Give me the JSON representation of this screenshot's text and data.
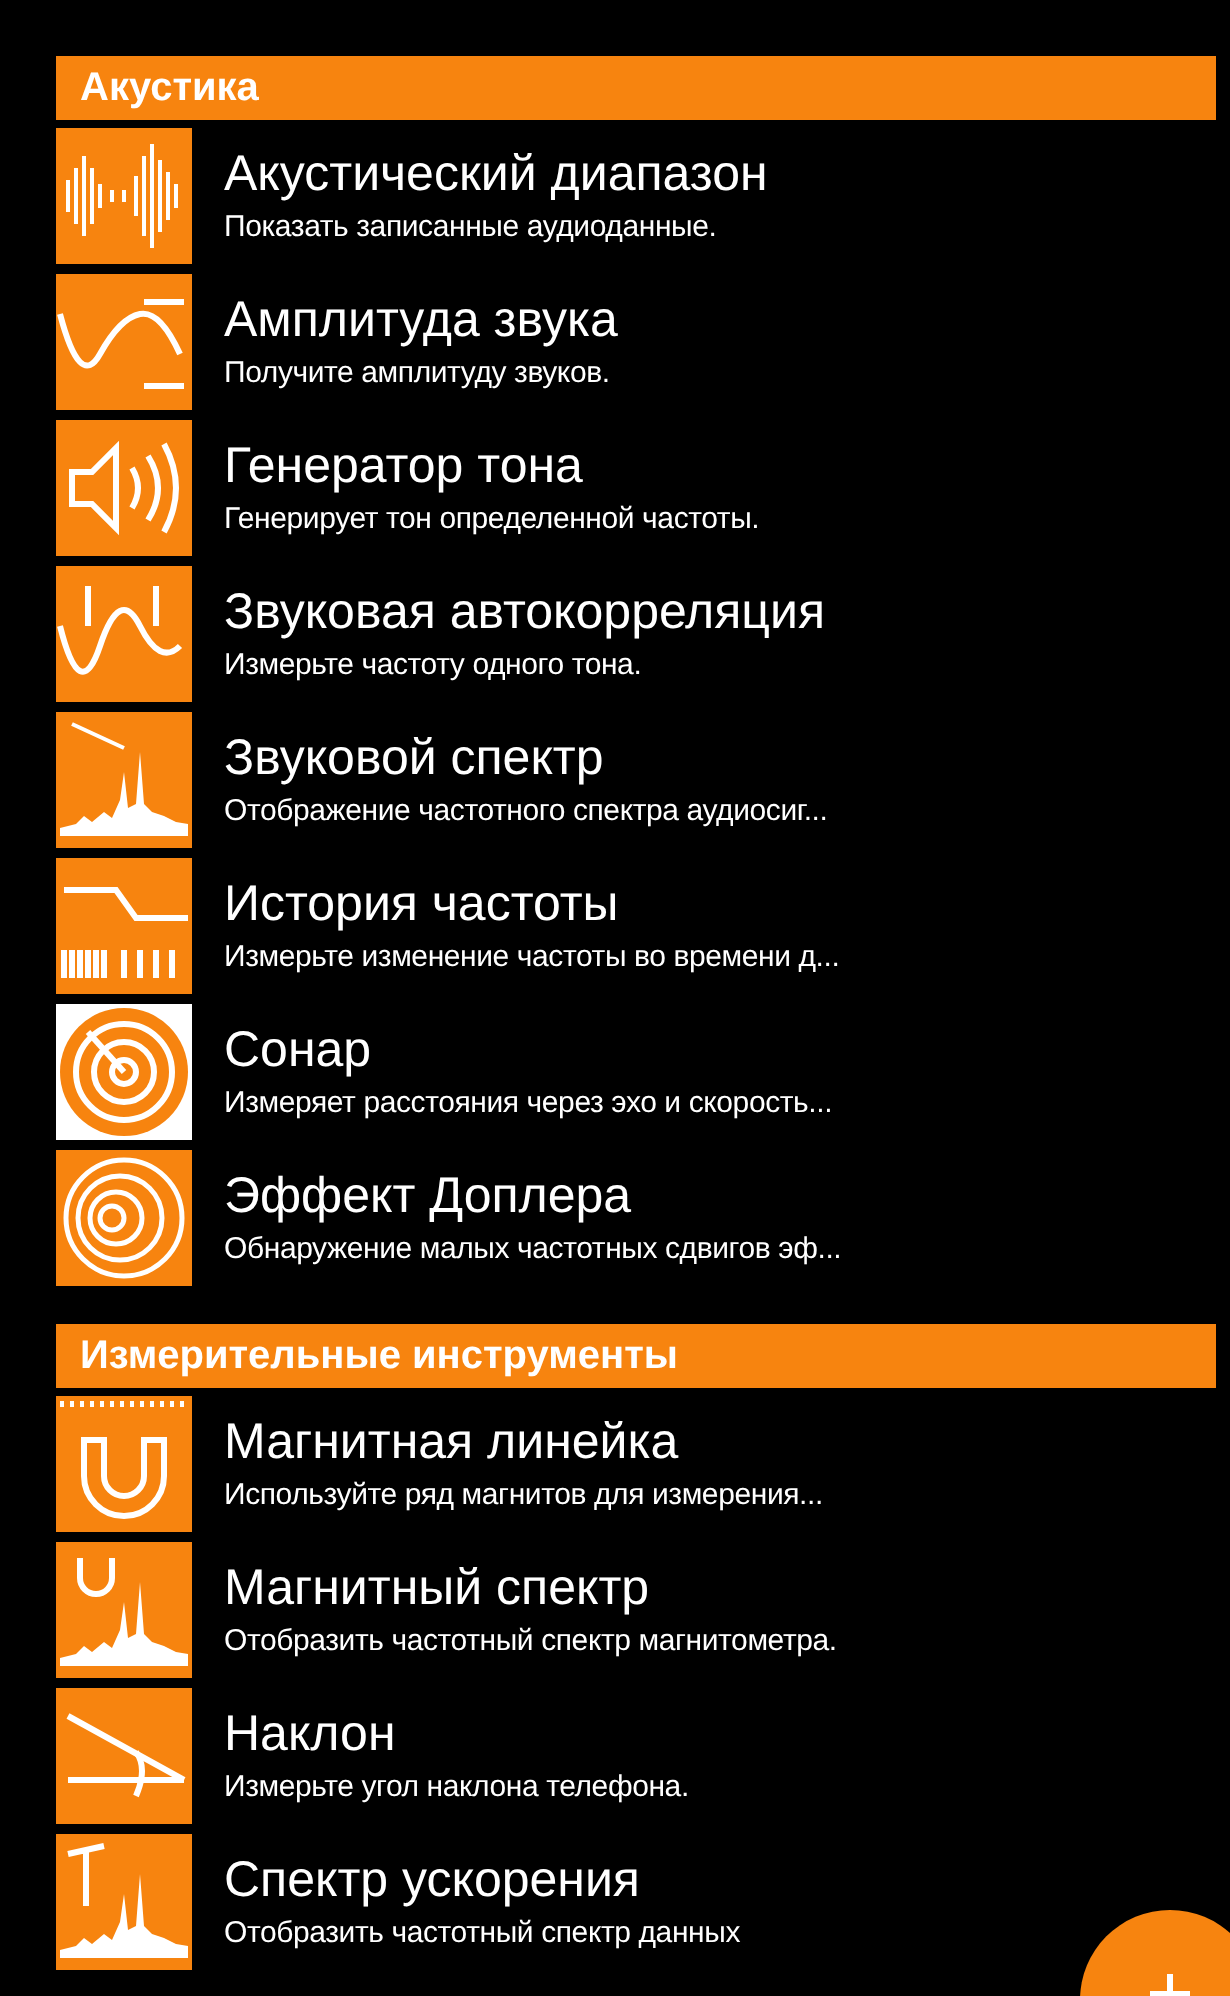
{
  "sections": [
    {
      "title": "Акустика",
      "items": [
        {
          "title": "Акустический диапазон",
          "subtitle": "Показать записанные аудиоданные."
        },
        {
          "title": "Амплитуда звука",
          "subtitle": "Получите амплитуду звуков."
        },
        {
          "title": "Генератор тона",
          "subtitle": "Генерирует тон определенной частоты."
        },
        {
          "title": "Звуковая автокорреляция",
          "subtitle": "Измерьте частоту одного тона."
        },
        {
          "title": "Звуковой спектр",
          "subtitle": "Отображение частотного спектра аудиосиг..."
        },
        {
          "title": "История частоты",
          "subtitle": "Измерьте изменение частоты во времени д..."
        },
        {
          "title": "Сонар",
          "subtitle": "Измеряет расстояния через эхо и скорость..."
        },
        {
          "title": "Эффект Доплера",
          "subtitle": "Обнаружение малых частотных сдвигов эф..."
        }
      ]
    },
    {
      "title": "Измерительные инструменты",
      "items": [
        {
          "title": "Магнитная линейка",
          "subtitle": "Используйте ряд магнитов для измерения..."
        },
        {
          "title": "Магнитный спектр",
          "subtitle": "Отобразить частотный спектр магнитометра."
        },
        {
          "title": "Наклон",
          "subtitle": "Измерьте угол наклона телефона."
        },
        {
          "title": "Спектр ускорения",
          "subtitle": "Отобразить частотный спектр данных"
        }
      ]
    }
  ]
}
